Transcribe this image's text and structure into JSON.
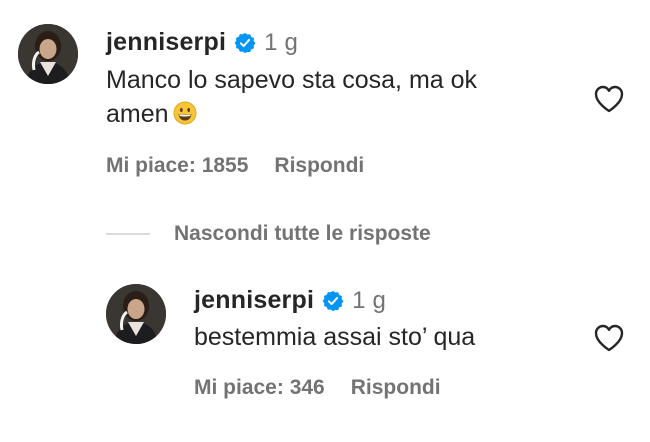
{
  "comments": [
    {
      "username": "jenniserpi",
      "time": "1 g",
      "text_line1": "Manco lo sapevo sta cosa, ma ok",
      "text_line2": "amen",
      "emoji": "grinning-face-icon",
      "likes_label": "Mi piace: 1855",
      "reply_label": "Rispondi"
    }
  ],
  "replies_toggle": {
    "label": "Nascondi tutte le risposte"
  },
  "replies": [
    {
      "username": "jenniserpi",
      "time": "1 g",
      "text": "bestemmia assai sto’ qua",
      "likes_label": "Mi piace: 346",
      "reply_label": "Rispondi"
    }
  ],
  "colors": {
    "text": "#262626",
    "secondary": "#737373",
    "verified": "#0095f6",
    "divider": "#dbdbdb"
  }
}
